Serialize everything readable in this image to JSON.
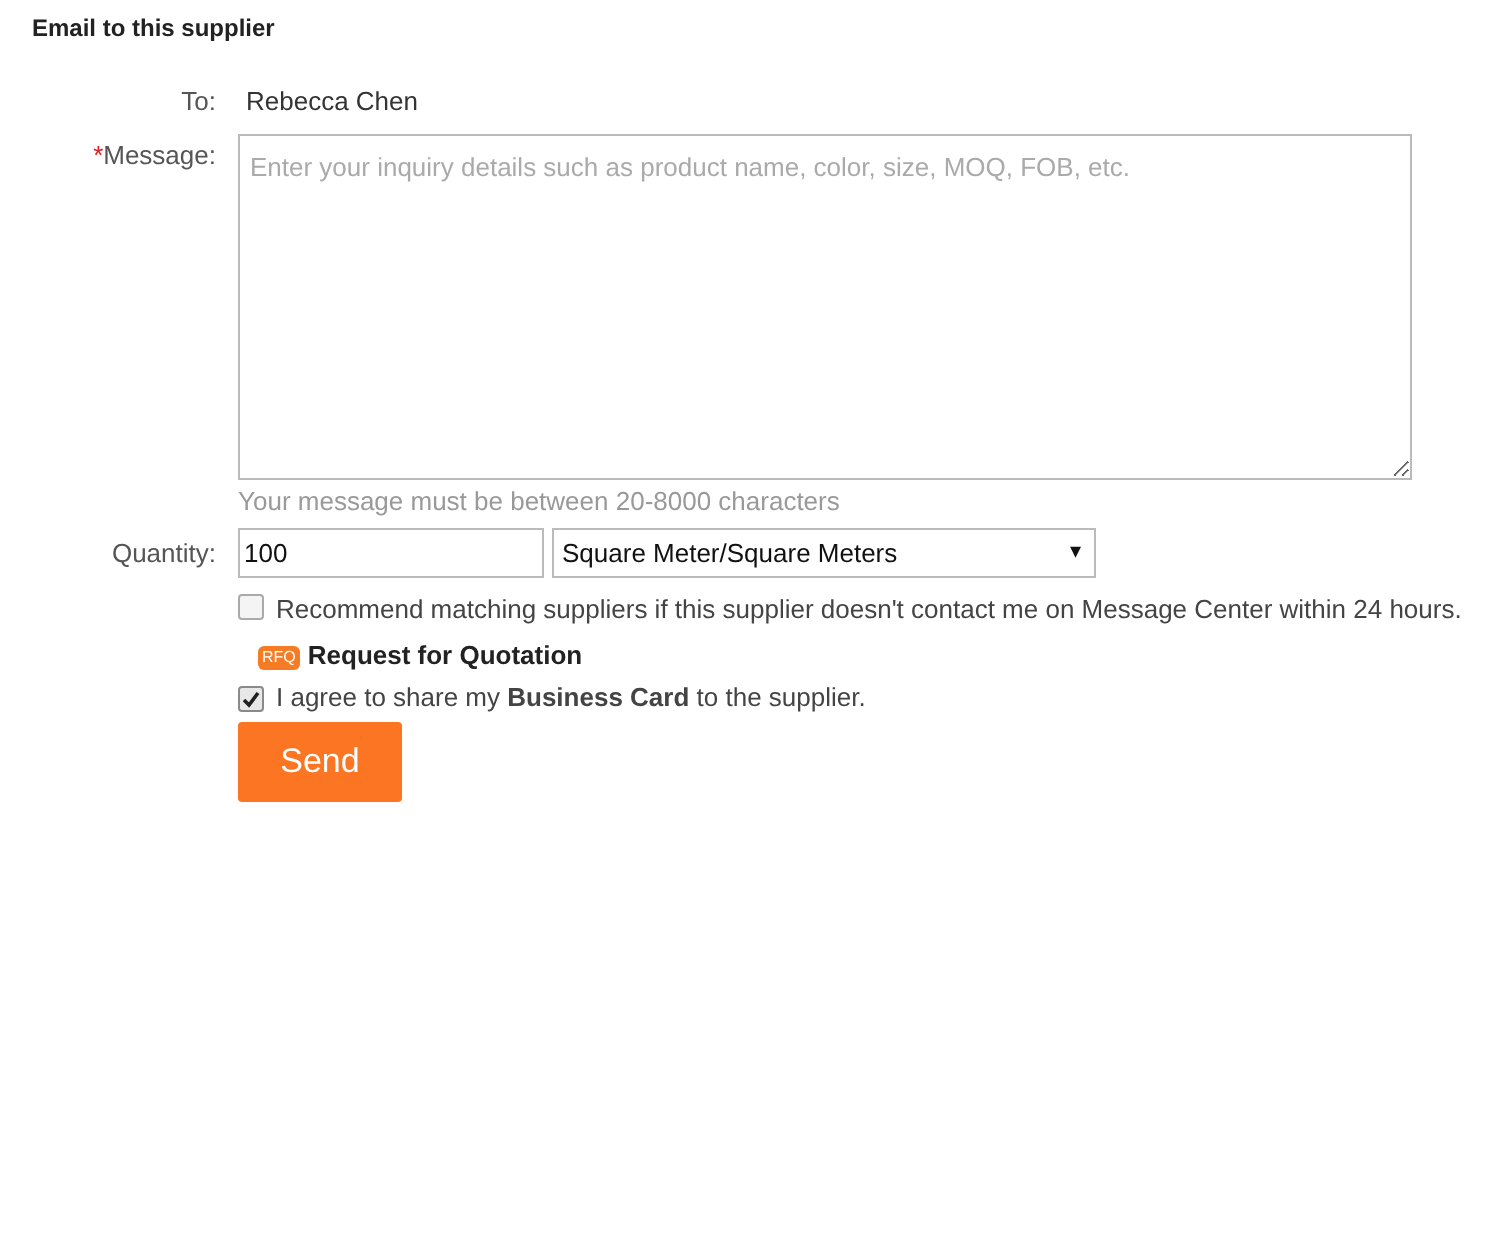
{
  "title": "Email to this supplier",
  "to": {
    "label": "To:",
    "value": "Rebecca Chen"
  },
  "message": {
    "required_mark": "*",
    "label": "Message:",
    "placeholder": "Enter your inquiry details such as product name, color, size, MOQ, FOB, etc.",
    "hint": "Your message must be between 20-8000 characters"
  },
  "quantity": {
    "label": "Quantity:",
    "value": "100",
    "unit": "Square Meter/Square Meters",
    "caret": "▾"
  },
  "recommend": {
    "checked": false,
    "text": "Recommend matching suppliers if this supplier doesn't contact me on Message Center within 24 hours.",
    "badge": "RFQ",
    "link": "Request for Quotation"
  },
  "agree": {
    "checked": true,
    "text": "I agree to share my **Business Card** to the supplier."
  },
  "send_button": "Send"
}
